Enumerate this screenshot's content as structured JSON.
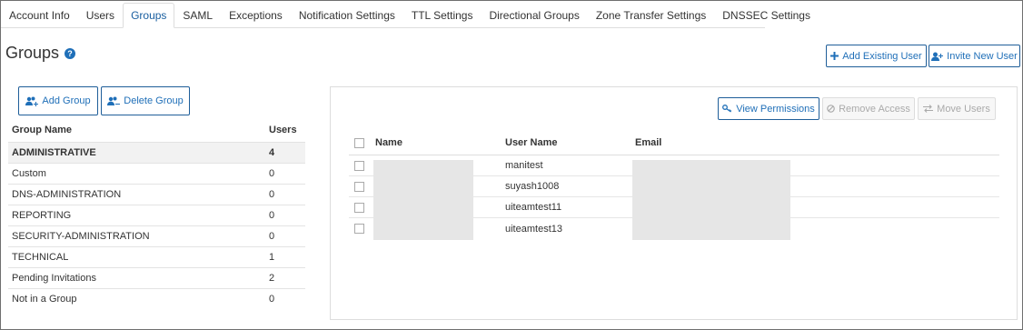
{
  "tabs": [
    {
      "label": "Account Info"
    },
    {
      "label": "Users"
    },
    {
      "label": "Groups"
    },
    {
      "label": "SAML"
    },
    {
      "label": "Exceptions"
    },
    {
      "label": "Notification Settings"
    },
    {
      "label": "TTL Settings"
    },
    {
      "label": "Directional Groups"
    },
    {
      "label": "Zone Transfer Settings"
    },
    {
      "label": "DNSSEC Settings"
    }
  ],
  "active_tab": "Groups",
  "page": {
    "title": "Groups",
    "help_icon": "?"
  },
  "header_buttons": {
    "add_existing_user": "Add Existing User",
    "invite_new_user": "Invite New User"
  },
  "group_buttons": {
    "add_group": "Add Group",
    "delete_group": "Delete Group"
  },
  "groups_table": {
    "columns": [
      "Group Name",
      "Users"
    ],
    "rows": [
      {
        "name": "ADMINISTRATIVE",
        "users": "4",
        "selected": true
      },
      {
        "name": "Custom",
        "users": "0"
      },
      {
        "name": "DNS-ADMINISTRATION",
        "users": "0"
      },
      {
        "name": "REPORTING",
        "users": "0"
      },
      {
        "name": "SECURITY-ADMINISTRATION",
        "users": "0"
      },
      {
        "name": "TECHNICAL",
        "users": "1"
      },
      {
        "name": "Pending Invitations",
        "users": "2"
      },
      {
        "name": "Not in a Group",
        "users": "0"
      }
    ]
  },
  "panel_buttons": {
    "view_permissions": "View Permissions",
    "remove_access": "Remove Access",
    "move_users": "Move Users"
  },
  "users_table": {
    "columns": [
      "Name",
      "User Name",
      "Email"
    ],
    "rows": [
      {
        "name": "",
        "username": "manitest",
        "email": ""
      },
      {
        "name": "",
        "username": "suyash1008",
        "email": ""
      },
      {
        "name": "",
        "username": "uiteamtest11",
        "email": ""
      },
      {
        "name": "",
        "username": "uiteamtest13",
        "email": ""
      }
    ]
  },
  "colors": {
    "accent": "#1f6fb8",
    "button_border": "#1f5e99",
    "disabled_text": "#aaaaaa"
  }
}
